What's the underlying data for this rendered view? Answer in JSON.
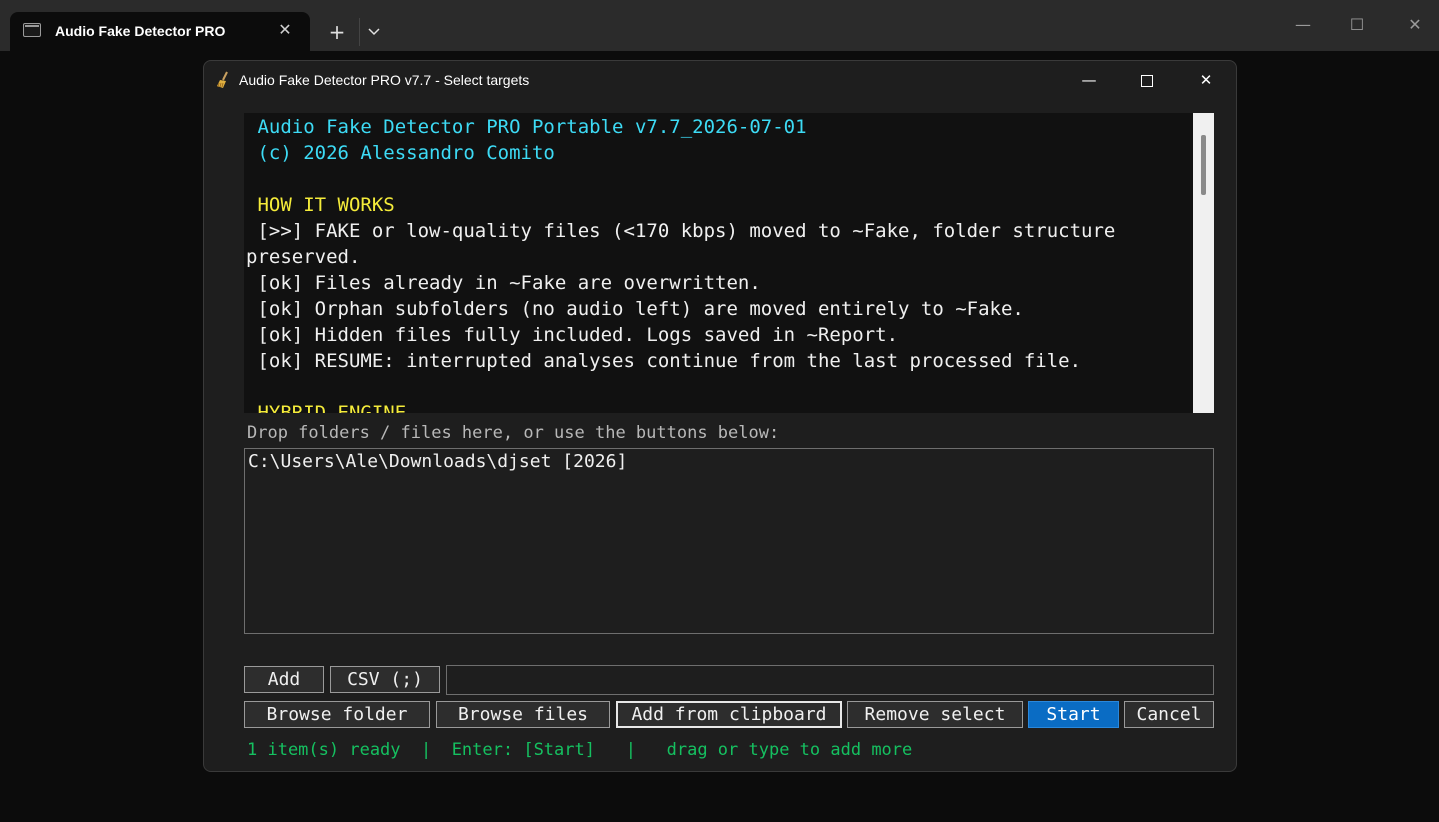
{
  "terminal": {
    "tab_title": "Audio Fake Detector PRO",
    "tab_close": "✕",
    "new_tab": "+",
    "tab_dropdown": "⌄",
    "minimize": "—",
    "maximize": "☐",
    "close": "✕"
  },
  "dialog": {
    "title": "Audio Fake Detector PRO v7.7 - Select targets",
    "icon": "broom-icon",
    "minimize": "—",
    "close": "✕"
  },
  "info": {
    "line1": " Audio Fake Detector PRO Portable v7.7_2026-07-01",
    "line2": " (c) 2026 Alessandro Comito",
    "section1": " HOW IT WORKS",
    "l1": " [>>] FAKE or low-quality files (<170 kbps) moved to ~Fake, folder structure preserved.",
    "l2": " [ok] Files already in ~Fake are overwritten.",
    "l3": " [ok] Orphan subfolders (no audio left) are moved entirely to ~Fake.",
    "l4": " [ok] Hidden files fully included. Logs saved in ~Report.",
    "l5": " [ok] RESUME: interrupted analyses continue from the last processed file.",
    "section2": " HYBRID ENGINE"
  },
  "drop_label": "Drop folders / files here, or use the buttons below:",
  "targets": [
    "C:\\Users\\Ale\\Downloads\\djset [2026]"
  ],
  "buttons": {
    "add": "Add",
    "csv": "CSV (;)",
    "browse_folder": "Browse folder",
    "browse_files": "Browse files",
    "add_clipboard": "Add from clipboard",
    "remove_select": "Remove select",
    "start": "Start",
    "cancel": "Cancel"
  },
  "csv_input": {
    "value": ""
  },
  "status": "1 item(s) ready  |  Enter: [Start]   |   drag or type to add more",
  "colors": {
    "cyan": "#3ddbf5",
    "yellow": "#f5ec3a",
    "status_green": "#15c060",
    "primary_blue": "#0a6cc4"
  }
}
